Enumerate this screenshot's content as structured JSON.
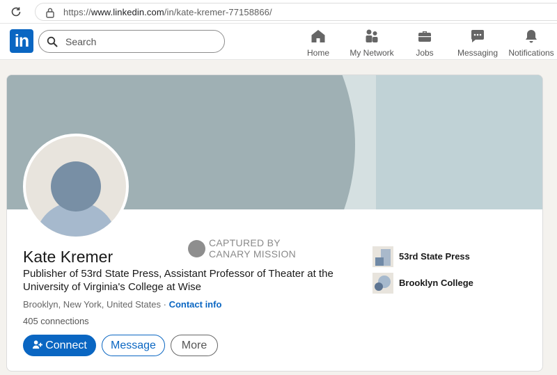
{
  "browser": {
    "url_prefix": "https://",
    "url_host": "www.linkedin.com",
    "url_path": "/in/kate-kremer-77158866/"
  },
  "nav": {
    "logo": "in",
    "search_placeholder": "Search",
    "items": [
      {
        "label": "Home",
        "icon": "home-icon"
      },
      {
        "label": "My Network",
        "icon": "my-network-icon"
      },
      {
        "label": "Jobs",
        "icon": "briefcase-icon"
      },
      {
        "label": "Messaging",
        "icon": "messaging-icon"
      },
      {
        "label": "Notifications",
        "icon": "bell-icon"
      }
    ]
  },
  "watermark": {
    "text": "CAPTURED BY\nCANARY MISSION"
  },
  "profile": {
    "name": "Kate Kremer",
    "headline": "Publisher of 53rd State Press, Assistant Professor of Theater at the University of Virginia's College at Wise",
    "location": "Brooklyn, New York, United States",
    "separator": " · ",
    "contact_info": "Contact info",
    "connections": "405 connections"
  },
  "actions": {
    "connect": "Connect",
    "message": "Message",
    "more": "More"
  },
  "organizations": [
    {
      "name": "53rd State Press",
      "icon": "company-logo-icon"
    },
    {
      "name": "Brooklyn College",
      "icon": "school-logo-icon"
    }
  ],
  "colors": {
    "brand": "#0a66c2",
    "cover": "#9fb0b4",
    "page_bg": "#f4f2ee"
  }
}
